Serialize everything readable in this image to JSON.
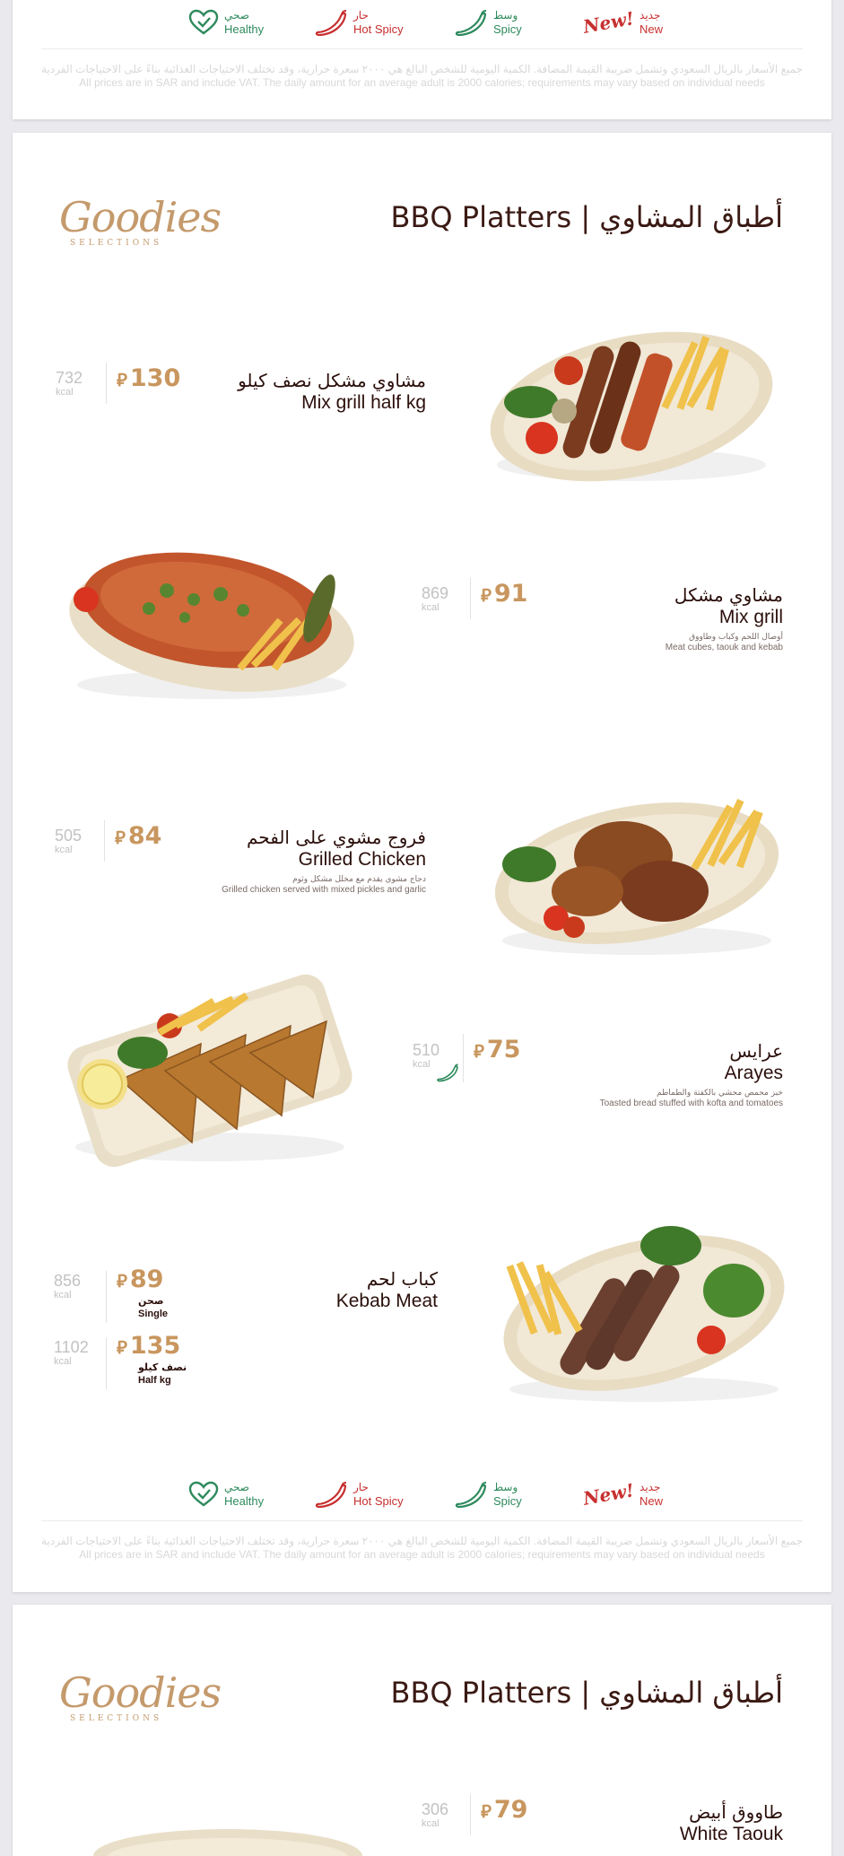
{
  "legend": {
    "healthy": {
      "ar": "صحي",
      "en": "Healthy",
      "icon": "heart-check-icon"
    },
    "hot_spicy": {
      "ar": "حار",
      "en": "Hot Spicy",
      "icon": "red-chili-icon"
    },
    "spicy": {
      "ar": "وسط",
      "en": "Spicy",
      "icon": "green-chili-icon"
    },
    "new": {
      "ar": "جديد",
      "en": "New",
      "badge": "New!"
    }
  },
  "disclaimer": {
    "ar": "جميع الأسعار بالريال السعودي وتشمل ضريبة القيمة المضافة. الكمية اليومية للشخص البالغ هي ٢٠٠٠ سعرة حرارية، وقد تختلف الاحتياجات الغذائية بناءً على الاحتياجات الفردية",
    "en": "All prices are in SAR and include VAT. The daily amount for an average adult is 2000 calories; requirements may vary based on individual needs"
  },
  "brand": {
    "logo": "Goodies",
    "sub": "SELECTIONS"
  },
  "page_title": "BBQ Platters | أطباق المشاوي",
  "currency_symbol": "⃁",
  "kcal_unit": "kcal",
  "items": [
    {
      "name_ar": "مشاوي مشكل نصف كيلو",
      "name_en": "Mix grill half kg",
      "price": "130",
      "kcal": "732"
    },
    {
      "name_ar": "مشاوي مشكل",
      "name_en": "Mix grill",
      "desc_ar": "أوصال اللحم وكباب وطاووق",
      "desc_en": "Meat cubes, taouk and kebab",
      "price": "91",
      "kcal": "869"
    },
    {
      "name_ar": "فروج مشوي على الفحم",
      "name_en": "Grilled Chicken",
      "desc_ar": "دجاج مشوي يقدم مع مخلل مشكل وثوم",
      "desc_en": "Grilled chicken served with mixed pickles and garlic",
      "price": "84",
      "kcal": "505"
    },
    {
      "name_ar": "عرايس",
      "name_en": "Arayes",
      "desc_ar": "خبز محمص محشي بالكفتة والطماطم",
      "desc_en": "Toasted bread stuffed with kofta and tomatoes",
      "price": "75",
      "kcal": "510",
      "spicy": true
    },
    {
      "name_ar": "كباب لحم",
      "name_en": "Kebab Meat",
      "prices": [
        {
          "price": "89",
          "kcal": "856",
          "size_ar": "صحن",
          "size_en": "Single"
        },
        {
          "price": "135",
          "kcal": "1102",
          "size_ar": "نصف كيلو",
          "size_en": "Half kg"
        }
      ]
    },
    {
      "name_ar": "طاووق أبيض",
      "name_en": "White Taouk",
      "price": "79",
      "kcal": "306"
    }
  ]
}
